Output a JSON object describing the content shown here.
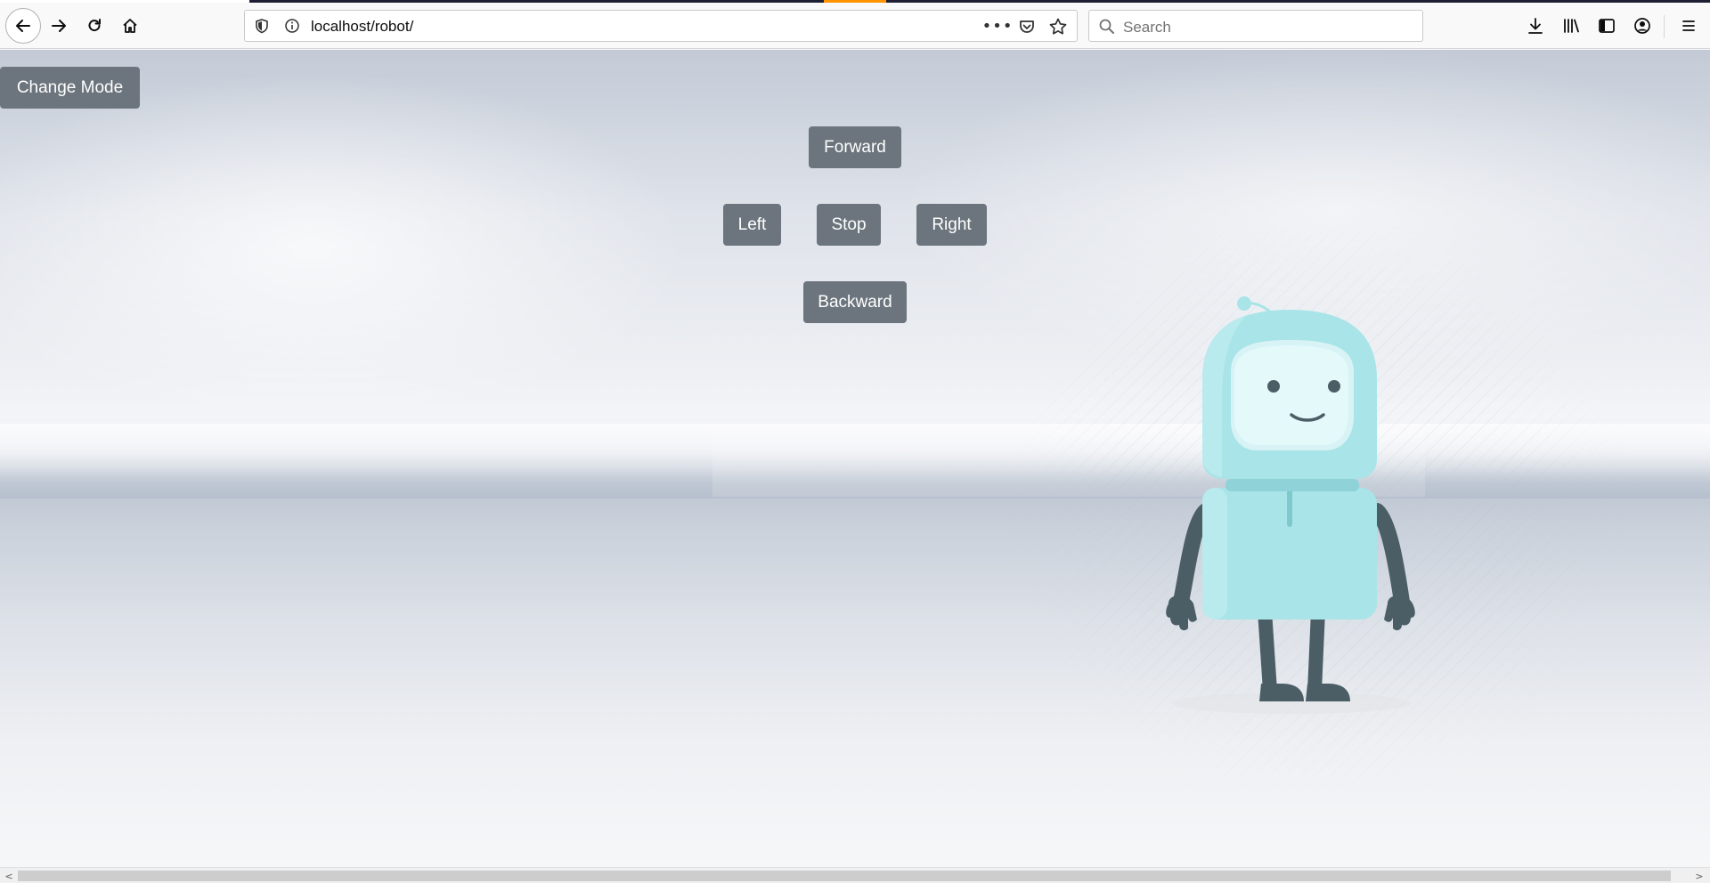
{
  "browser": {
    "url": "localhost/robot/",
    "search_placeholder": "Search",
    "more_glyph": "•••",
    "icons": [
      "back-icon",
      "forward-icon",
      "reload-icon",
      "home-icon",
      "shield-icon",
      "info-icon",
      "page-actions-icon",
      "pocket-icon",
      "bookmark-star-icon",
      "search-icon",
      "download-icon",
      "library-icon",
      "sidebar-icon",
      "account-icon",
      "menu-icon"
    ]
  },
  "page": {
    "mode_button": "Change Mode",
    "controls": {
      "forward": "Forward",
      "left": "Left",
      "stop": "Stop",
      "right": "Right",
      "backward": "Backward"
    }
  },
  "scrollbar": {
    "left_arrow": "<",
    "right_arrow": ">"
  },
  "colors": {
    "button_bg": "#6c757d",
    "robot_body": "#a8e4e8",
    "robot_limbs": "#4b5e66"
  }
}
